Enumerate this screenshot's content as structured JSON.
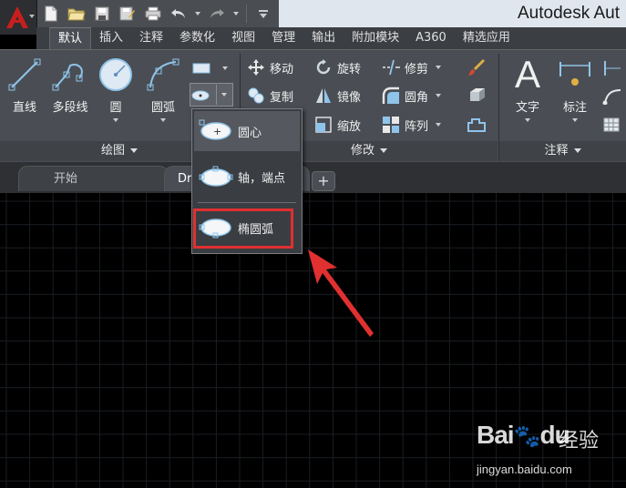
{
  "window": {
    "title": "Autodesk Aut",
    "accent_color": "#c81e1e"
  },
  "quick_access": {
    "icons": [
      "new-file-icon",
      "open-folder-icon",
      "save-icon",
      "save-as-icon",
      "print-icon",
      "undo-icon",
      "redo-icon",
      "customize-icon"
    ]
  },
  "ribbon_tabs": [
    {
      "label": "默认",
      "active": true
    },
    {
      "label": "插入"
    },
    {
      "label": "注释"
    },
    {
      "label": "参数化"
    },
    {
      "label": "视图"
    },
    {
      "label": "管理"
    },
    {
      "label": "输出"
    },
    {
      "label": "附加模块"
    },
    {
      "label": "A360"
    },
    {
      "label": "精选应用"
    }
  ],
  "draw_panel": {
    "title": "绘图",
    "tools": [
      {
        "label": "直线",
        "icon": "line-icon"
      },
      {
        "label": "多段线",
        "icon": "polyline-icon"
      },
      {
        "label": "圆",
        "icon": "circle-icon"
      },
      {
        "label": "圆弧",
        "icon": "arc-icon"
      }
    ],
    "small_tools": [
      {
        "icon": "rectangle-icon"
      },
      {
        "icon": "ellipse-icon"
      }
    ]
  },
  "modify_panel": {
    "title": "修改",
    "tools": [
      {
        "label": "移动",
        "icon": "move-icon"
      },
      {
        "label": "旋转",
        "icon": "rotate-icon"
      },
      {
        "label": "修剪",
        "icon": "trim-icon"
      },
      {
        "label": "复制",
        "icon": "copy-icon"
      },
      {
        "label": "镜像",
        "icon": "mirror-icon"
      },
      {
        "label": "圆角",
        "icon": "fillet-icon"
      },
      {
        "label": "缩放",
        "icon": "scale-icon"
      },
      {
        "label": "阵列",
        "icon": "array-icon"
      }
    ]
  },
  "annotation_panel": {
    "title": "注释",
    "tools": [
      {
        "label": "文字",
        "icon": "text-icon"
      },
      {
        "label": "标注",
        "icon": "dimension-icon"
      }
    ]
  },
  "doc_tabs": [
    {
      "label": "开始"
    },
    {
      "label": "Dr",
      "active": true
    }
  ],
  "ellipse_dropdown": {
    "items": [
      {
        "label": "圆心",
        "icon": "ellipse-center-icon"
      },
      {
        "label": "轴，端点",
        "icon": "ellipse-axis-end-icon"
      },
      {
        "label": "椭圆弧",
        "icon": "elliptical-arc-icon",
        "highlighted": true
      }
    ],
    "highlight_color": "#e03030"
  },
  "watermark": {
    "brand": "Bai",
    "brand_tail": "du",
    "cn": "经验",
    "url": "jingyan.baidu.com"
  }
}
